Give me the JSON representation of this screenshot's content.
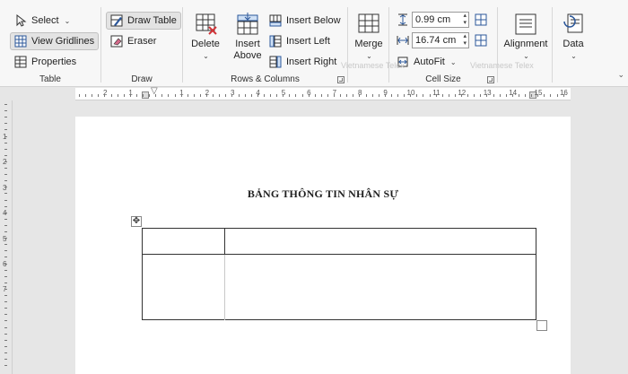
{
  "ribbon": {
    "table_group": {
      "select": "Select",
      "view_gridlines": "View Gridlines",
      "properties": "Properties",
      "label": "Table"
    },
    "draw_group": {
      "draw_table": "Draw Table",
      "eraser": "Eraser",
      "label": "Draw"
    },
    "rows_columns_group": {
      "delete": "Delete",
      "insert_above_line1": "Insert",
      "insert_above_line2": "Above",
      "insert_below": "Insert Below",
      "insert_left": "Insert Left",
      "insert_right": "Insert Right",
      "label": "Rows & Columns"
    },
    "merge_group": {
      "merge": "Merge"
    },
    "cell_size_group": {
      "height": "0.99 cm",
      "width": "16.74 cm",
      "autofit": "AutoFit",
      "label": "Cell Size"
    },
    "alignment_group": {
      "alignment": "Alignment"
    },
    "data_group": {
      "data": "Data"
    },
    "watermarks": [
      "Vietnamese Telex",
      "Vietnamese Telex"
    ],
    "accent_color": "#2b579a"
  },
  "ruler": {
    "labels": [
      "2",
      "1",
      "1",
      "2",
      "3",
      "4",
      "5",
      "6",
      "7",
      "8",
      "9",
      "10",
      "11",
      "12",
      "13",
      "14",
      "15",
      "16"
    ],
    "vertical_labels": [
      "1",
      "2",
      "3",
      "4",
      "5",
      "6",
      "7"
    ]
  },
  "document": {
    "title": "BẢNG THÔNG TIN NHÂN SỰ"
  }
}
